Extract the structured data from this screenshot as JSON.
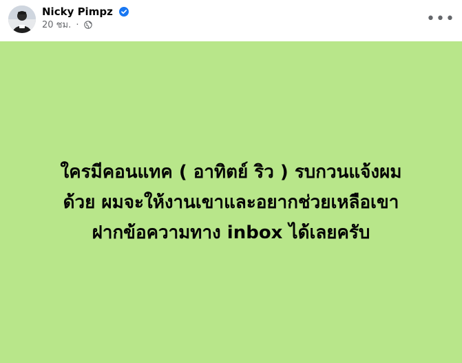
{
  "post": {
    "author_name": "Nicky Pimpz",
    "timestamp": "20 ชม.",
    "separator": "·",
    "audience_icon": "globe-icon",
    "verified_icon": "verified-badge-icon",
    "more_icon": "more-options-icon",
    "body_lines": [
      "ใครมีคอนแทค ( อาทิตย์ ริว ) รบกวนแจ้งผม",
      "ด้วย ผมจะให้งานเขาและอยากช่วยเหลือเขา",
      "ฝากข้อความทาง inbox ได้เลยครับ"
    ]
  },
  "colors": {
    "background_post": "#b8e68a",
    "verified_blue": "#1877f2",
    "meta_gray": "#65676b",
    "text": "#050505"
  }
}
